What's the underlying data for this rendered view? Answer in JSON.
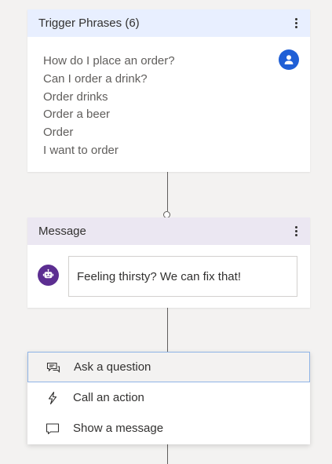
{
  "trigger": {
    "title": "Trigger Phrases (6)",
    "phrases": [
      "How do I place an order?",
      "Can I order a drink?",
      "Order drinks",
      "Order a beer",
      "Order",
      "I want to order"
    ]
  },
  "message": {
    "title": "Message",
    "text": "Feeling thirsty? We can fix that!"
  },
  "menu": {
    "items": [
      {
        "label": "Ask a question",
        "icon": "chat-question-icon"
      },
      {
        "label": "Call an action",
        "icon": "lightning-icon"
      },
      {
        "label": "Show a message",
        "icon": "message-bubble-icon"
      }
    ]
  },
  "colors": {
    "trigger_header": "#e8efff",
    "message_header": "#ebe7f2",
    "user_avatar": "#1f5fd6",
    "bot_avatar": "#5c2e91",
    "selected_border": "#8fb4e6"
  }
}
